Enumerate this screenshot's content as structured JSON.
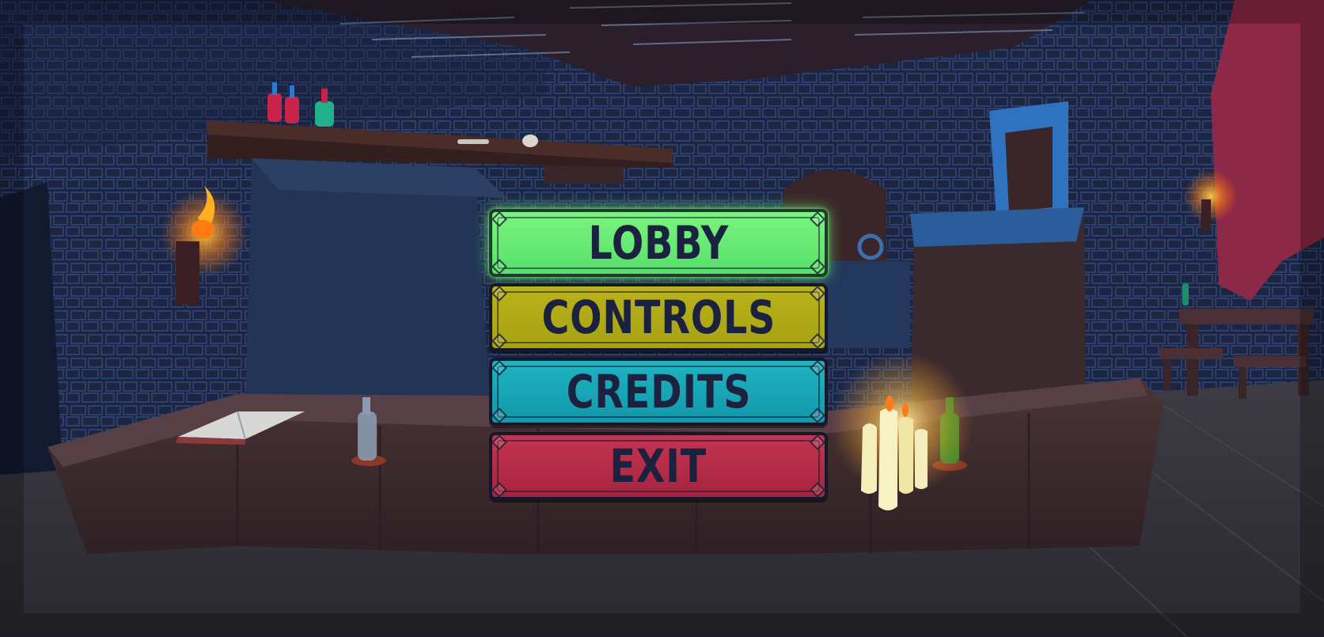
{
  "menu": {
    "lobby_label": "LOBBY",
    "controls_label": "CONTROLS",
    "credits_label": "CREDITS",
    "exit_label": "EXIT",
    "selected": "LOBBY"
  },
  "colors": {
    "lobby": "#6fee79",
    "controls": "#b3ad18",
    "credits": "#18a8b8",
    "exit": "#b82d4a",
    "text": "#1b2240"
  }
}
